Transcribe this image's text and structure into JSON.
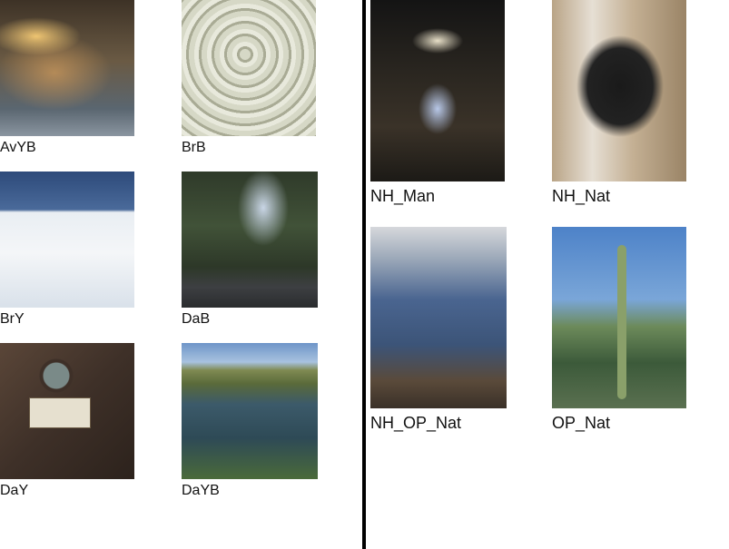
{
  "left_panel": {
    "tiles": [
      {
        "label": "AvYB"
      },
      {
        "label": "BrB"
      },
      {
        "label": "BrY"
      },
      {
        "label": "DaB"
      },
      {
        "label": "DaY"
      },
      {
        "label": "DaYB"
      }
    ]
  },
  "right_panel": {
    "tiles": [
      {
        "label": "NH_Man"
      },
      {
        "label": "NH_Nat"
      },
      {
        "label": "NH_OP_Nat"
      },
      {
        "label": "OP_Nat"
      }
    ]
  }
}
